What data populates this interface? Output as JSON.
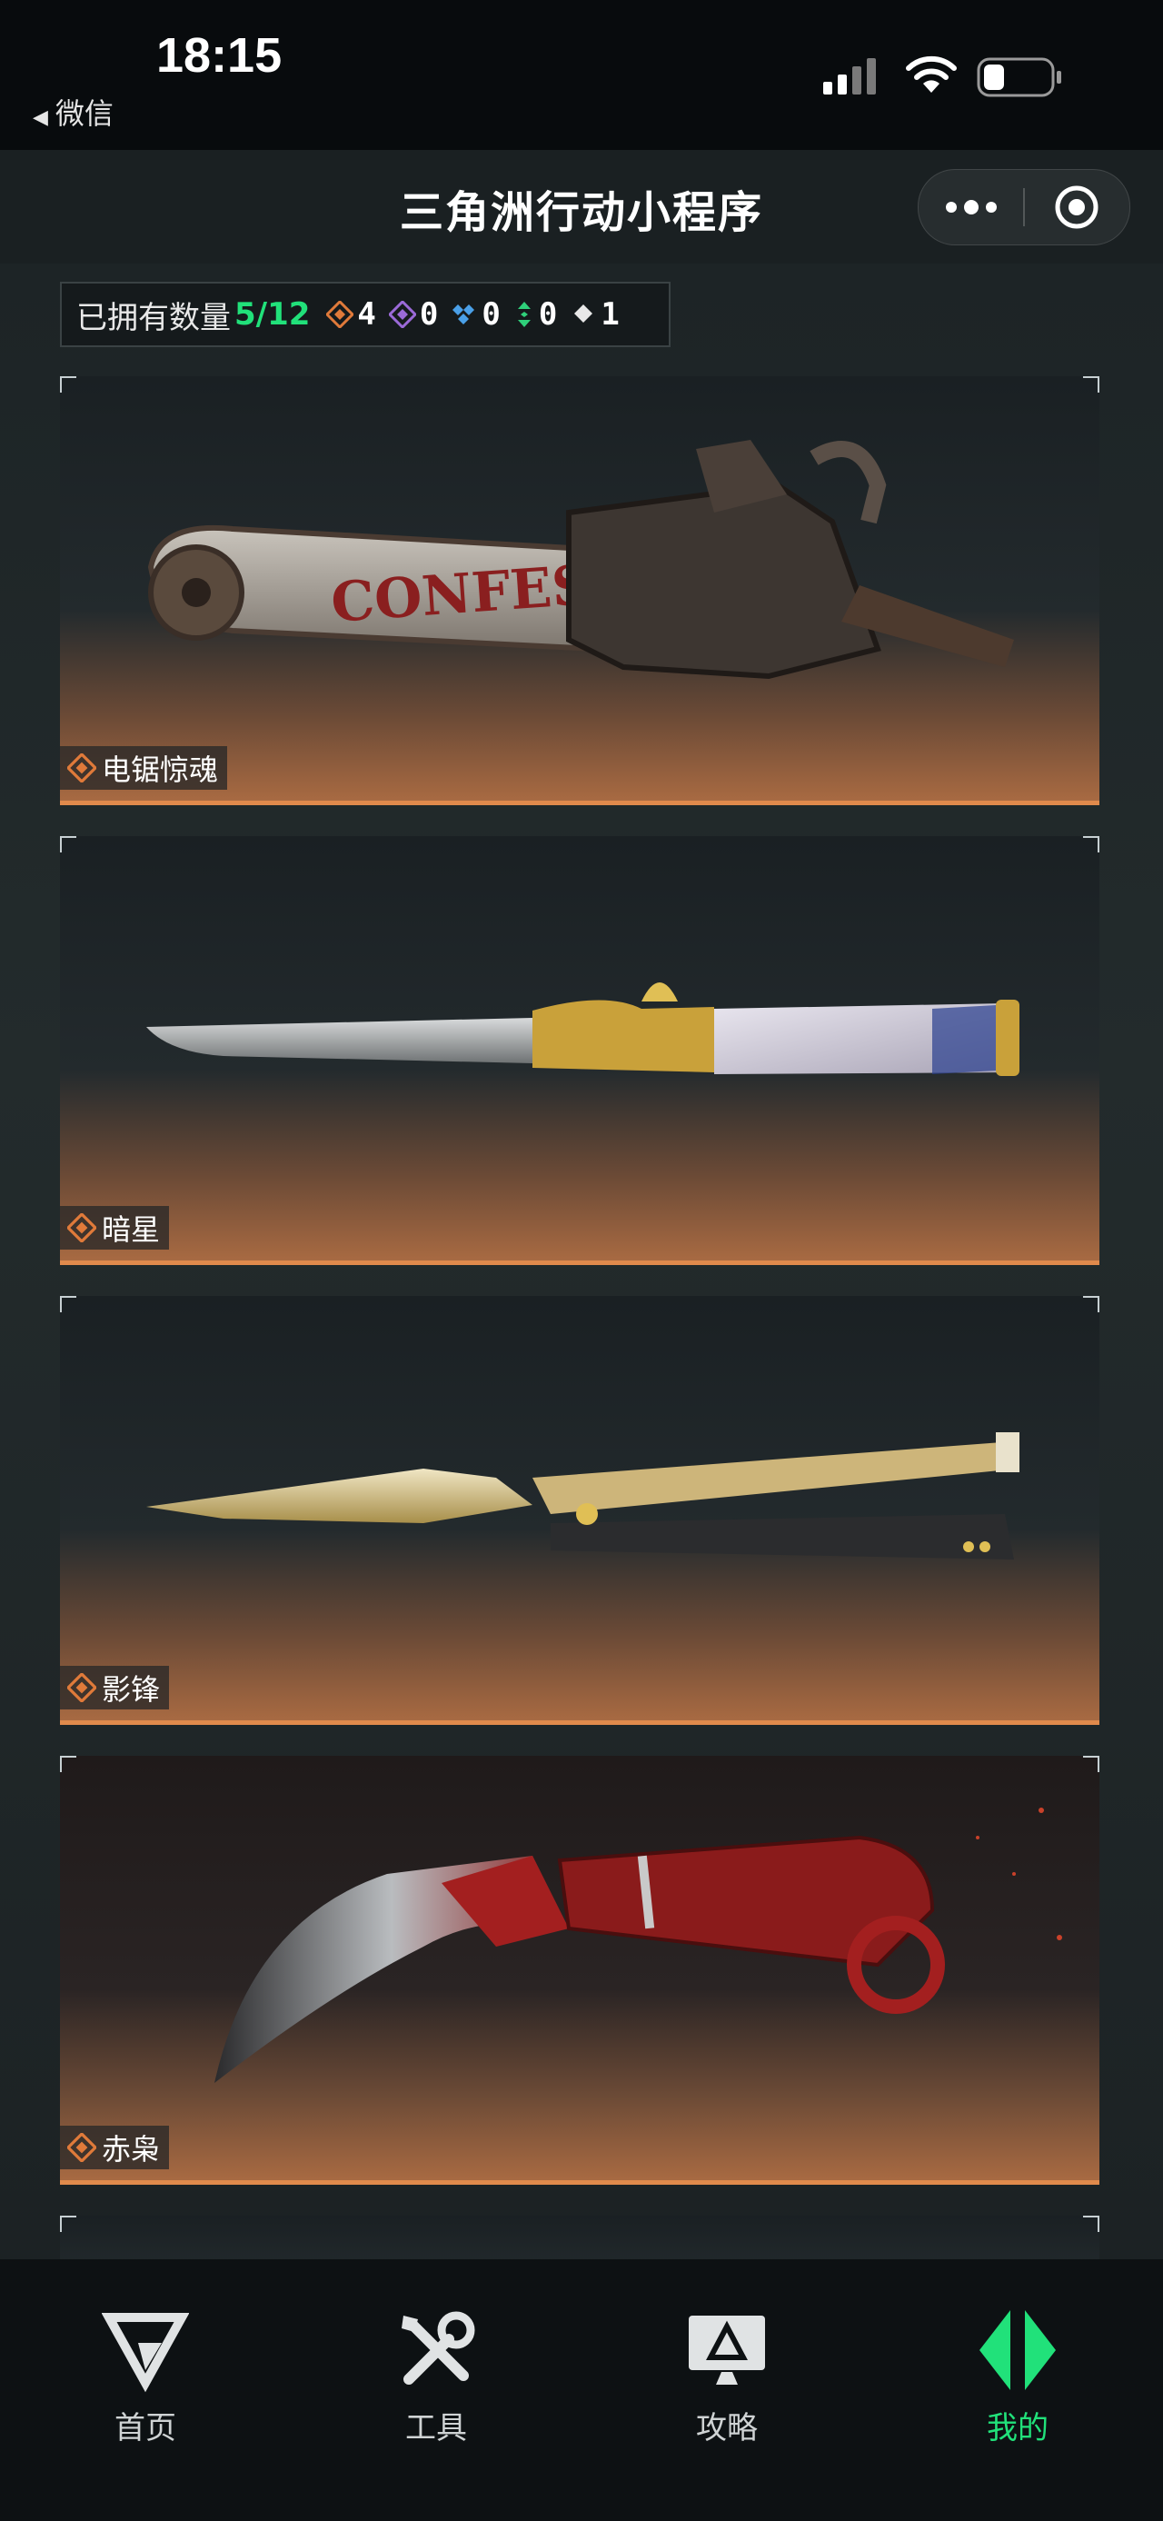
{
  "status_bar": {
    "time": "18:15",
    "back_label": "微信"
  },
  "nav": {
    "title": "三角洲行动小程序"
  },
  "owned": {
    "label": "已拥有数量",
    "count": "5/12",
    "stats": [
      {
        "icon": "orange-diamond-icon",
        "color": "#e07a3a",
        "value": "4"
      },
      {
        "icon": "purple-diamond-icon",
        "color": "#9b6ad8",
        "value": "0"
      },
      {
        "icon": "blue-diamond-icon",
        "color": "#4aa0e8",
        "value": "0"
      },
      {
        "icon": "green-arrow-icon",
        "color": "#2fd07a",
        "value": "0"
      },
      {
        "icon": "white-diamond-icon",
        "color": "#e8e8e8",
        "value": "1"
      }
    ]
  },
  "items": [
    {
      "name": "电锯惊魂",
      "rarity_color": "#e07a3a"
    },
    {
      "name": "暗星",
      "rarity_color": "#e07a3a"
    },
    {
      "name": "影锋",
      "rarity_color": "#e07a3a"
    },
    {
      "name": "赤枭",
      "rarity_color": "#e07a3a"
    }
  ],
  "tabbar": {
    "tabs": [
      {
        "label": "首页",
        "icon": "home-logo-icon"
      },
      {
        "label": "工具",
        "icon": "tools-icon"
      },
      {
        "label": "攻略",
        "icon": "guide-monitor-icon"
      },
      {
        "label": "我的",
        "icon": "profile-logo-icon",
        "active": true
      }
    ],
    "active_color": "#21e17a"
  }
}
